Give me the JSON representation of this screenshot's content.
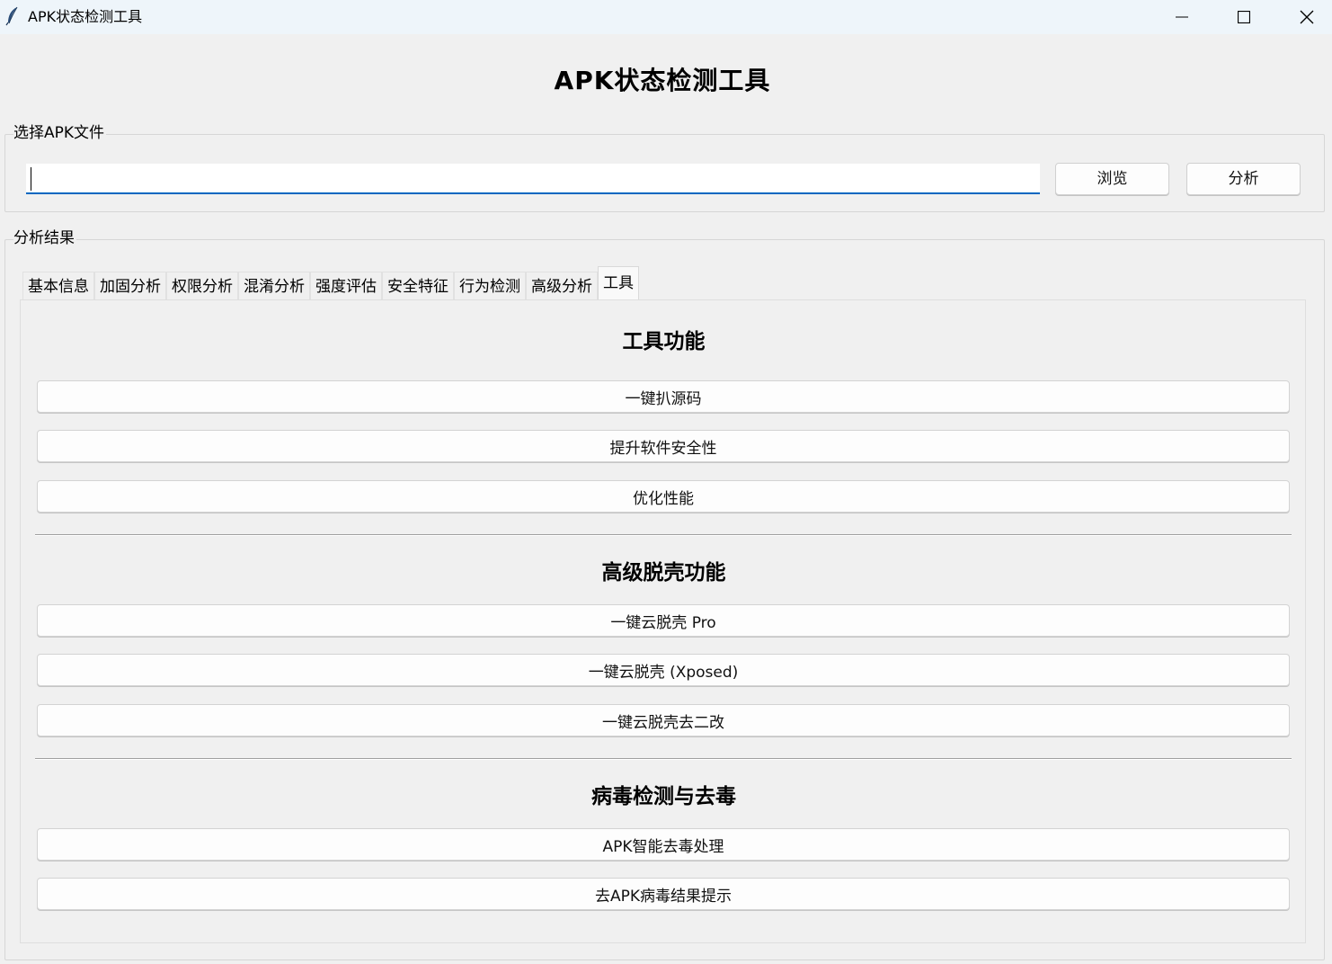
{
  "window": {
    "title": "APK状态检测工具",
    "icon": "feather-icon",
    "controls": [
      "minimize-icon",
      "maximize-icon",
      "close-icon"
    ]
  },
  "header": {
    "title": "APK状态检测工具"
  },
  "file_group": {
    "label": "选择APK文件",
    "path_value": "",
    "browse_label": "浏览",
    "analyze_label": "分析"
  },
  "result_group": {
    "label": "分析结果",
    "tabs": [
      {
        "label": "基本信息"
      },
      {
        "label": "加固分析"
      },
      {
        "label": "权限分析"
      },
      {
        "label": "混淆分析"
      },
      {
        "label": "强度评估"
      },
      {
        "label": "安全特征"
      },
      {
        "label": "行为检测"
      },
      {
        "label": "高级分析"
      },
      {
        "label": "工具"
      }
    ],
    "active_tab": "工具"
  },
  "tools": {
    "sections": [
      {
        "title": "工具功能",
        "buttons": [
          "一键扒源码",
          "提升软件安全性",
          "优化性能"
        ]
      },
      {
        "title": "高级脱壳功能",
        "buttons": [
          "一键云脱壳 Pro",
          "一键云脱壳 (Xposed)",
          "一键云脱壳去二改"
        ]
      },
      {
        "title": "病毒检测与去毒",
        "buttons": [
          "APK智能去毒处理",
          "去APK病毒结果提示"
        ]
      }
    ]
  },
  "colors": {
    "titlebar_bg": "#eef5fa",
    "window_bg": "#f0f0f0",
    "input_focus": "#0067c0"
  }
}
